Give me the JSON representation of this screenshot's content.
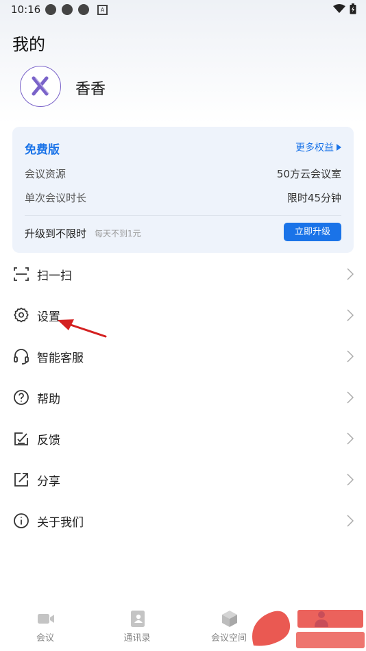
{
  "status": {
    "time": "10:16"
  },
  "page": {
    "title": "我的"
  },
  "profile": {
    "name": "香香"
  },
  "plan": {
    "title": "免费版",
    "more_label": "更多权益",
    "rows": [
      {
        "label": "会议资源",
        "value": "50方云会议室"
      },
      {
        "label": "单次会议时长",
        "value": "限时45分钟"
      }
    ],
    "upgrade_label": "升级到不限时",
    "upgrade_sub": "每天不到1元",
    "upgrade_button": "立即升级"
  },
  "menu": [
    {
      "label": "扫一扫",
      "icon": "scan-icon"
    },
    {
      "label": "设置",
      "icon": "gear-icon"
    },
    {
      "label": "智能客服",
      "icon": "headset-icon"
    },
    {
      "label": "帮助",
      "icon": "help-icon"
    },
    {
      "label": "反馈",
      "icon": "feedback-icon"
    },
    {
      "label": "分享",
      "icon": "share-icon"
    },
    {
      "label": "关于我们",
      "icon": "info-icon"
    }
  ],
  "tabs": [
    {
      "label": "会议",
      "icon": "video-icon"
    },
    {
      "label": "通讯录",
      "icon": "contacts-icon"
    },
    {
      "label": "会议空间",
      "icon": "cube-icon"
    }
  ],
  "colors": {
    "accent": "#1a73e8",
    "annotation_arrow": "#d42020"
  }
}
